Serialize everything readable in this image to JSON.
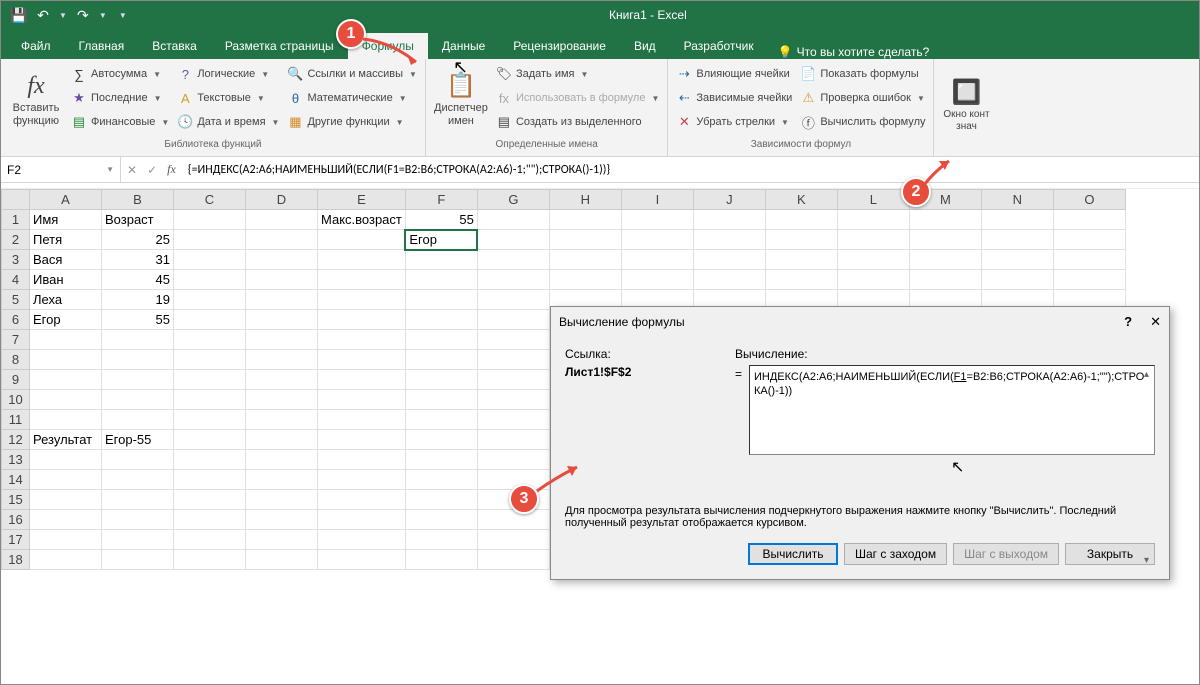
{
  "title": "Книга1  -  Excel",
  "qat": {
    "save": "💾",
    "undo": "↶",
    "redo": "↷"
  },
  "tabs": {
    "file": "Файл",
    "home": "Главная",
    "insert": "Вставка",
    "layout": "Разметка страницы",
    "formulas": "Формулы",
    "data": "Данные",
    "review": "Рецензирование",
    "view": "Вид",
    "developer": "Разработчик",
    "tell_me": "Что вы хотите сделать?"
  },
  "ribbon": {
    "insert_function": "Вставить\nфункцию",
    "library": {
      "autosum": "Автосумма",
      "recent": "Последние",
      "financial": "Финансовые",
      "logical": "Логические",
      "text": "Текстовые",
      "date": "Дата и время",
      "lookup": "Ссылки и массивы",
      "math": "Математические",
      "more": "Другие функции",
      "title": "Библиотека функций"
    },
    "names": {
      "manager": "Диспетчер\nимен",
      "define": "Задать имя",
      "use": "Использовать в формуле",
      "create": "Создать из выделенного",
      "title": "Определенные имена"
    },
    "audit": {
      "trace_prec": "Влияющие ячейки",
      "trace_dep": "Зависимые ячейки",
      "remove_arrows": "Убрать стрелки",
      "show_formulas": "Показать формулы",
      "error_check": "Проверка ошибок",
      "evaluate": "Вычислить формулу",
      "title": "Зависимости формул"
    },
    "watch": "Окно конт\nзнач"
  },
  "namebox": "F2",
  "formula": "{=ИНДЕКС(A2:A6;НАИМЕНЬШИЙ(ЕСЛИ(F1=B2:B6;СТРОКА(A2:A6)-1;\"\");СТРОКА()-1))}",
  "columns": [
    "A",
    "B",
    "C",
    "D",
    "E",
    "F",
    "G",
    "H",
    "I",
    "J",
    "K",
    "L",
    "M",
    "N",
    "O"
  ],
  "rows": [
    "1",
    "2",
    "3",
    "4",
    "5",
    "6",
    "7",
    "8",
    "9",
    "10",
    "11",
    "12",
    "13",
    "14",
    "15",
    "16",
    "17",
    "18"
  ],
  "cells": {
    "A1": "Имя",
    "B1": "Возраст",
    "A2": "Петя",
    "B2": "25",
    "A3": "Вася",
    "B3": "31",
    "A4": "Иван",
    "B4": "45",
    "A5": "Леха",
    "B5": "19",
    "A6": "Егор",
    "B6": "55",
    "A12": "Результат",
    "B12": "Егор-55",
    "E1": "Макс.возраст",
    "F1": "55",
    "F2": "Егор"
  },
  "dialog": {
    "title": "Вычисление формулы",
    "ref_label": "Ссылка:",
    "ref_value": "Лист1!$F$2",
    "calc_label": "Вычисление:",
    "calc_text_pre": "ИНДЕКС(A2:A6;НАИМЕНЬШИЙ(ЕСЛИ(",
    "calc_text_ul": "F1",
    "calc_text_post": "=B2:B6;СТРОКА(A2:A6)-1;\"\");СТРОКА()-1))",
    "hint": "Для просмотра результата вычисления подчеркнутого выражения нажмите кнопку \"Вычислить\". Последний полученный результат отображается курсивом.",
    "btn_eval": "Вычислить",
    "btn_stepin": "Шаг с заходом",
    "btn_stepout": "Шаг с выходом",
    "btn_close": "Закрыть"
  },
  "callouts": {
    "c1": "1",
    "c2": "2",
    "c3": "3"
  }
}
